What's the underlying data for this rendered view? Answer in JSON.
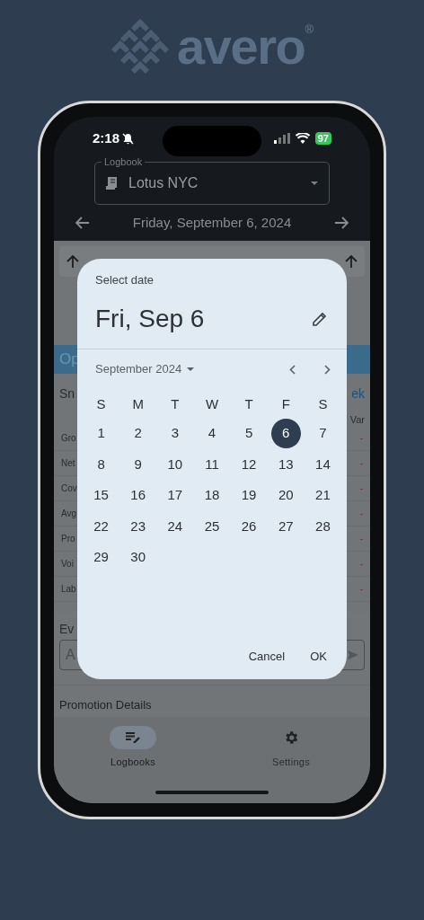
{
  "logo": {
    "text": "avero",
    "mark": "®"
  },
  "status_bar": {
    "time": "2:18",
    "battery": "97"
  },
  "logbook": {
    "label": "Logbook",
    "value": "Lotus NYC"
  },
  "date_nav": {
    "title": "Friday, September 6, 2024"
  },
  "background": {
    "section_header": "Op",
    "snapshot_label": "Sn",
    "snapshot_link": "ek",
    "column_header": "Var",
    "rows": [
      {
        "label": "Gro",
        "value": "-"
      },
      {
        "label": "Net",
        "value": "-"
      },
      {
        "label": "Cov",
        "value": "-"
      },
      {
        "label": "Avg",
        "value": "-"
      },
      {
        "label": "Pro",
        "value": "-"
      },
      {
        "label": "Voi",
        "value": "-"
      },
      {
        "label": "Lab",
        "value": "-"
      }
    ],
    "events_label": "Ev",
    "events_placeholder": "A",
    "promotion_label": "Promotion Details"
  },
  "dialog": {
    "title": "Select date",
    "selected_date": "Fri, Sep 6",
    "month": "September 2024",
    "weekdays": [
      "S",
      "M",
      "T",
      "W",
      "T",
      "F",
      "S"
    ],
    "days": [
      {
        "label": "1",
        "selected": false
      },
      {
        "label": "2",
        "selected": false
      },
      {
        "label": "3",
        "selected": false
      },
      {
        "label": "4",
        "selected": false
      },
      {
        "label": "5",
        "selected": false
      },
      {
        "label": "6",
        "selected": true
      },
      {
        "label": "7",
        "selected": false
      },
      {
        "label": "8",
        "selected": false
      },
      {
        "label": "9",
        "selected": false
      },
      {
        "label": "10",
        "selected": false
      },
      {
        "label": "11",
        "selected": false
      },
      {
        "label": "12",
        "selected": false
      },
      {
        "label": "13",
        "selected": false
      },
      {
        "label": "14",
        "selected": false
      },
      {
        "label": "15",
        "selected": false
      },
      {
        "label": "16",
        "selected": false
      },
      {
        "label": "17",
        "selected": false
      },
      {
        "label": "18",
        "selected": false
      },
      {
        "label": "19",
        "selected": false
      },
      {
        "label": "20",
        "selected": false
      },
      {
        "label": "21",
        "selected": false
      },
      {
        "label": "22",
        "selected": false
      },
      {
        "label": "23",
        "selected": false
      },
      {
        "label": "24",
        "selected": false
      },
      {
        "label": "25",
        "selected": false
      },
      {
        "label": "26",
        "selected": false
      },
      {
        "label": "27",
        "selected": false
      },
      {
        "label": "28",
        "selected": false
      },
      {
        "label": "29",
        "selected": false
      },
      {
        "label": "30",
        "selected": false
      }
    ],
    "buttons": [
      "Cancel",
      "OK"
    ]
  },
  "bottom_nav": [
    {
      "label": "Logbooks",
      "kind": "logbooks",
      "selected": true
    },
    {
      "label": "Settings",
      "kind": "settings",
      "selected": false
    }
  ]
}
